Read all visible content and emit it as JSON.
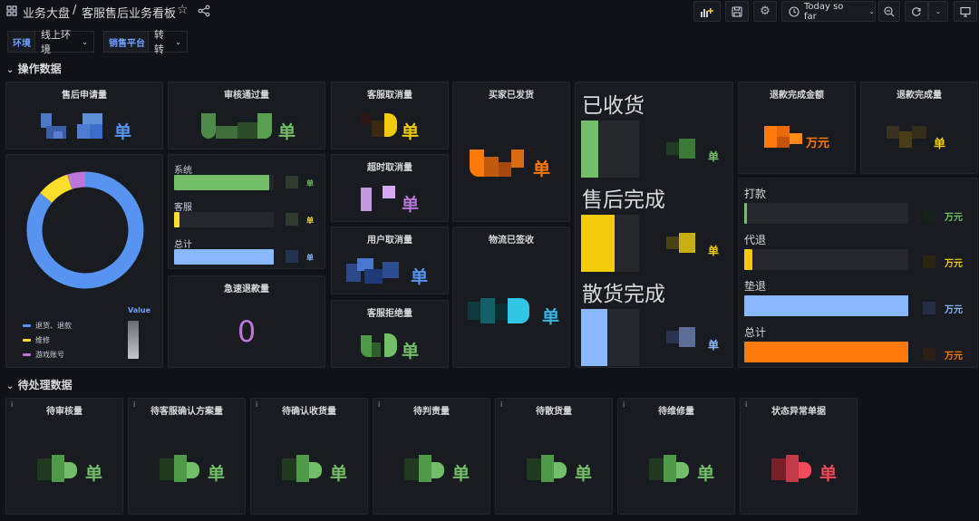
{
  "header": {
    "folder": "业务大盘",
    "separator": "/",
    "dashboard_title": "客服售后业务看板",
    "time_range": "Today so far"
  },
  "variables": [
    {
      "label": "环境",
      "value": "线上环境"
    },
    {
      "label": "销售平台",
      "value": "转转"
    }
  ],
  "rows": {
    "ops": "操作数据",
    "pending": "待处理数据"
  },
  "panels": {
    "after_sale_apply": {
      "title": "售后申请量",
      "unit": "单"
    },
    "review_passed": {
      "title": "审核通过量",
      "unit": "单"
    },
    "cs_cancel": {
      "title": "客服取消量",
      "unit": "单"
    },
    "buyer_shipped": {
      "title": "买家已发货",
      "unit": "单"
    },
    "timeout_cancel": {
      "title": "超时取消量",
      "unit": "单"
    },
    "user_cancel": {
      "title": "用户取消量",
      "unit": "单"
    },
    "logistics_signed": {
      "title": "物流已签收",
      "unit": "单"
    },
    "cs_reject": {
      "title": "客服拒绝量",
      "unit": "单"
    },
    "express_refund": {
      "title": "急速退款量",
      "value": "0"
    },
    "refund_amount": {
      "title": "退款完成金额",
      "unit": "万元"
    },
    "refund_count": {
      "title": "退款完成量",
      "unit": "单"
    }
  },
  "review_breakdown": {
    "items": [
      {
        "label": "系统",
        "unit": "单",
        "color": "#73bf69",
        "fill": 0.95
      },
      {
        "label": "客服",
        "unit": "单",
        "color": "#fade2a",
        "fill": 0.05
      },
      {
        "label": "总计",
        "unit": "单",
        "color": "#8ab8ff",
        "fill": 1.0
      }
    ]
  },
  "donut": {
    "legend_header": "Value",
    "legend": [
      {
        "label": "退货、退款",
        "color": "#5794f2"
      },
      {
        "label": "维修",
        "color": "#fade2a"
      },
      {
        "label": "游戏账号",
        "color": "#b877d9"
      }
    ],
    "slices": [
      0.86,
      0.09,
      0.05
    ]
  },
  "gauges": [
    {
      "label": "已收货",
      "unit": "单",
      "color": "#73bf69",
      "fill": 0.3
    },
    {
      "label": "售后完成",
      "unit": "单",
      "color": "#f2cc0c",
      "fill": 0.58
    },
    {
      "label": "散货完成",
      "unit": "单",
      "color": "#8ab8ff",
      "fill": 0.45
    }
  ],
  "refund_breakdown": {
    "items": [
      {
        "label": "打款",
        "unit": "万元",
        "color": "#73bf69",
        "fill": 0.01
      },
      {
        "label": "代退",
        "unit": "万元",
        "color": "#f2cc0c",
        "fill": 0.05
      },
      {
        "label": "垫退",
        "unit": "万元",
        "color": "#8ab8ff",
        "fill": 1.0
      },
      {
        "label": "总计",
        "unit": "万元",
        "color": "#ff780a",
        "fill": 1.0
      }
    ]
  },
  "pending_panels": [
    {
      "title": "待审核量",
      "unit": "单",
      "color": "#73bf69"
    },
    {
      "title": "待客服确认方案量",
      "unit": "单",
      "color": "#73bf69"
    },
    {
      "title": "待确认收货量",
      "unit": "单",
      "color": "#73bf69"
    },
    {
      "title": "待判责量",
      "unit": "单",
      "color": "#73bf69"
    },
    {
      "title": "待散货量",
      "unit": "单",
      "color": "#73bf69"
    },
    {
      "title": "待维修量",
      "unit": "单",
      "color": "#73bf69"
    },
    {
      "title": "状态异常单据",
      "unit": "单",
      "color": "#f2495c"
    }
  ],
  "colors": {
    "background": "#111217",
    "panel": "#181b1f",
    "accent_blue": "#5794f2",
    "green": "#73bf69",
    "yellow": "#f2cc0c",
    "orange": "#ff780a",
    "purple": "#b877d9",
    "cyan": "#33b5e5",
    "red": "#f2495c"
  }
}
